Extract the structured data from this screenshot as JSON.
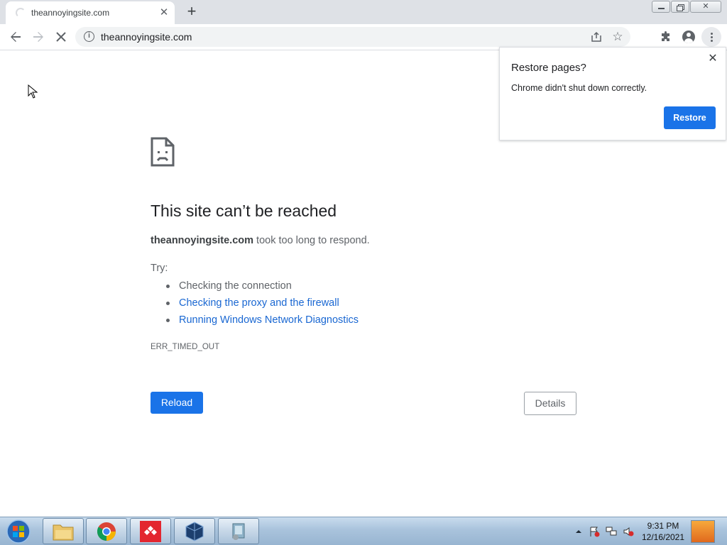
{
  "browser": {
    "tab": {
      "title": "theannoyingsite.com",
      "close_glyph": "✕"
    },
    "new_tab_glyph": "+",
    "omnibox": {
      "url": "theannoyingsite.com"
    }
  },
  "restore_bubble": {
    "title": "Restore pages?",
    "message": "Chrome didn't shut down correctly.",
    "button": "Restore",
    "close_glyph": "✕"
  },
  "error_page": {
    "title": "This site can’t be reached",
    "host": "theannoyingsite.com",
    "description_rest": " took too long to respond.",
    "try_label": "Try:",
    "suggestions": [
      {
        "text": "Checking the connection",
        "link": false
      },
      {
        "text": "Checking the proxy and the firewall",
        "link": true
      },
      {
        "text": "Running Windows Network Diagnostics",
        "link": true
      }
    ],
    "error_code": "ERR_TIMED_OUT",
    "reload_button": "Reload",
    "details_button": "Details"
  },
  "taskbar": {
    "apps": [
      "explorer-icon",
      "chrome-icon",
      "anydesk-icon",
      "virtualbox-icon",
      "app-icon"
    ],
    "clock_time": "9:31 PM",
    "clock_date": "12/16/2021"
  },
  "colors": {
    "accent": "#1a73e8",
    "link": "#1967d2"
  }
}
